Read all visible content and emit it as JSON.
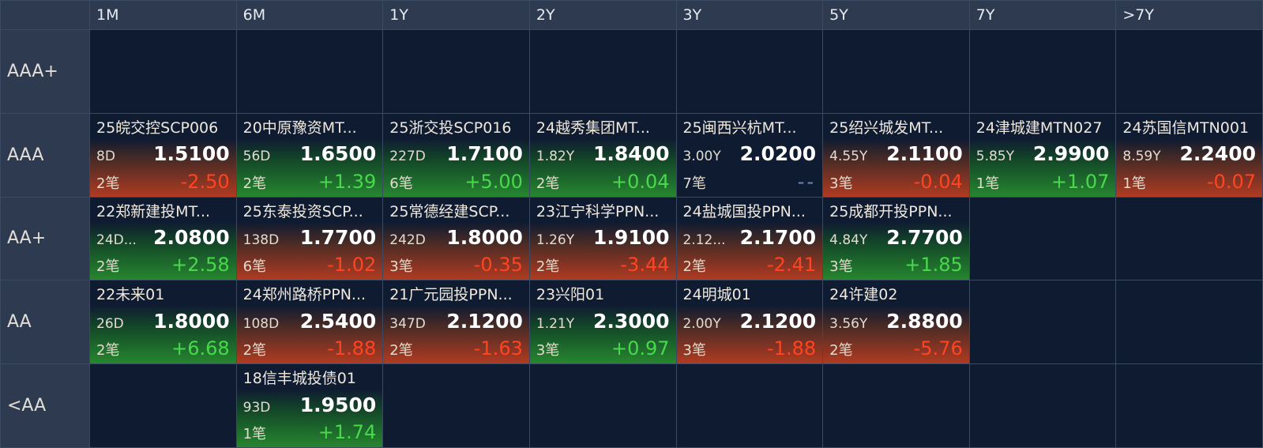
{
  "columns": [
    "1M",
    "6M",
    "1Y",
    "2Y",
    "3Y",
    "5Y",
    "7Y",
    ">7Y"
  ],
  "rows": [
    {
      "label": "AAA+",
      "cells": [
        null,
        null,
        null,
        null,
        null,
        null,
        null,
        null
      ]
    },
    {
      "label": "AAA",
      "cells": [
        {
          "name": "25皖交控SCP006",
          "term": "8D",
          "price": "1.5100",
          "count": "2笔",
          "change": "-2.50",
          "dir": "down"
        },
        {
          "name": "20中原豫资MT...",
          "term": "56D",
          "price": "1.6500",
          "count": "2笔",
          "change": "+1.39",
          "dir": "up"
        },
        {
          "name": "25浙交投SCP016",
          "term": "227D",
          "price": "1.7100",
          "count": "6笔",
          "change": "+5.00",
          "dir": "up"
        },
        {
          "name": "24越秀集团MT...",
          "term": "1.82Y",
          "price": "1.8400",
          "count": "2笔",
          "change": "+0.04",
          "dir": "up"
        },
        {
          "name": "25闽西兴杭MT...",
          "term": "3.00Y",
          "price": "2.0200",
          "count": "7笔",
          "change": "--",
          "dir": "flat"
        },
        {
          "name": "25绍兴城发MT...",
          "term": "4.55Y",
          "price": "2.1100",
          "count": "3笔",
          "change": "-0.04",
          "dir": "down"
        },
        {
          "name": "24津城建MTN027",
          "term": "5.85Y",
          "price": "2.9900",
          "count": "1笔",
          "change": "+1.07",
          "dir": "up"
        },
        {
          "name": "24苏国信MTN001",
          "term": "8.59Y",
          "price": "2.2400",
          "count": "1笔",
          "change": "-0.07",
          "dir": "down"
        }
      ]
    },
    {
      "label": "AA+",
      "cells": [
        {
          "name": "22郑新建投MT...",
          "term": "24D...",
          "price": "2.0800",
          "count": "2笔",
          "change": "+2.58",
          "dir": "up"
        },
        {
          "name": "25东泰投资SCP...",
          "term": "138D",
          "price": "1.7700",
          "count": "6笔",
          "change": "-1.02",
          "dir": "down"
        },
        {
          "name": "25常德经建SCP...",
          "term": "242D",
          "price": "1.8000",
          "count": "3笔",
          "change": "-0.35",
          "dir": "down"
        },
        {
          "name": "23江宁科学PPN...",
          "term": "1.26Y",
          "price": "1.9100",
          "count": "2笔",
          "change": "-3.44",
          "dir": "down"
        },
        {
          "name": "24盐城国投PPN...",
          "term": "2.12...",
          "price": "2.1700",
          "count": "2笔",
          "change": "-2.41",
          "dir": "down"
        },
        {
          "name": "25成都开投PPN...",
          "term": "4.84Y",
          "price": "2.7700",
          "count": "3笔",
          "change": "+1.85",
          "dir": "up"
        },
        null,
        null
      ]
    },
    {
      "label": "AA",
      "cells": [
        {
          "name": "22未来01",
          "term": "26D",
          "price": "1.8000",
          "count": "2笔",
          "change": "+6.68",
          "dir": "up"
        },
        {
          "name": "24郑州路桥PPN...",
          "term": "108D",
          "price": "2.5400",
          "count": "2笔",
          "change": "-1.88",
          "dir": "down"
        },
        {
          "name": "21广元园投PPN...",
          "term": "347D",
          "price": "2.1200",
          "count": "2笔",
          "change": "-1.63",
          "dir": "down"
        },
        {
          "name": "23兴阳01",
          "term": "1.21Y",
          "price": "2.3000",
          "count": "3笔",
          "change": "+0.97",
          "dir": "up"
        },
        {
          "name": "24明城01",
          "term": "2.00Y",
          "price": "2.1200",
          "count": "3笔",
          "change": "-1.88",
          "dir": "down"
        },
        {
          "name": "24许建02",
          "term": "3.56Y",
          "price": "2.8800",
          "count": "2笔",
          "change": "-5.76",
          "dir": "down"
        },
        null,
        null
      ]
    },
    {
      "label": "<AA",
      "cells": [
        null,
        {
          "name": "18信丰城投债01",
          "term": "93D",
          "price": "1.9500",
          "count": "1笔",
          "change": "+1.74",
          "dir": "up"
        },
        null,
        null,
        null,
        null,
        null,
        null
      ]
    }
  ]
}
